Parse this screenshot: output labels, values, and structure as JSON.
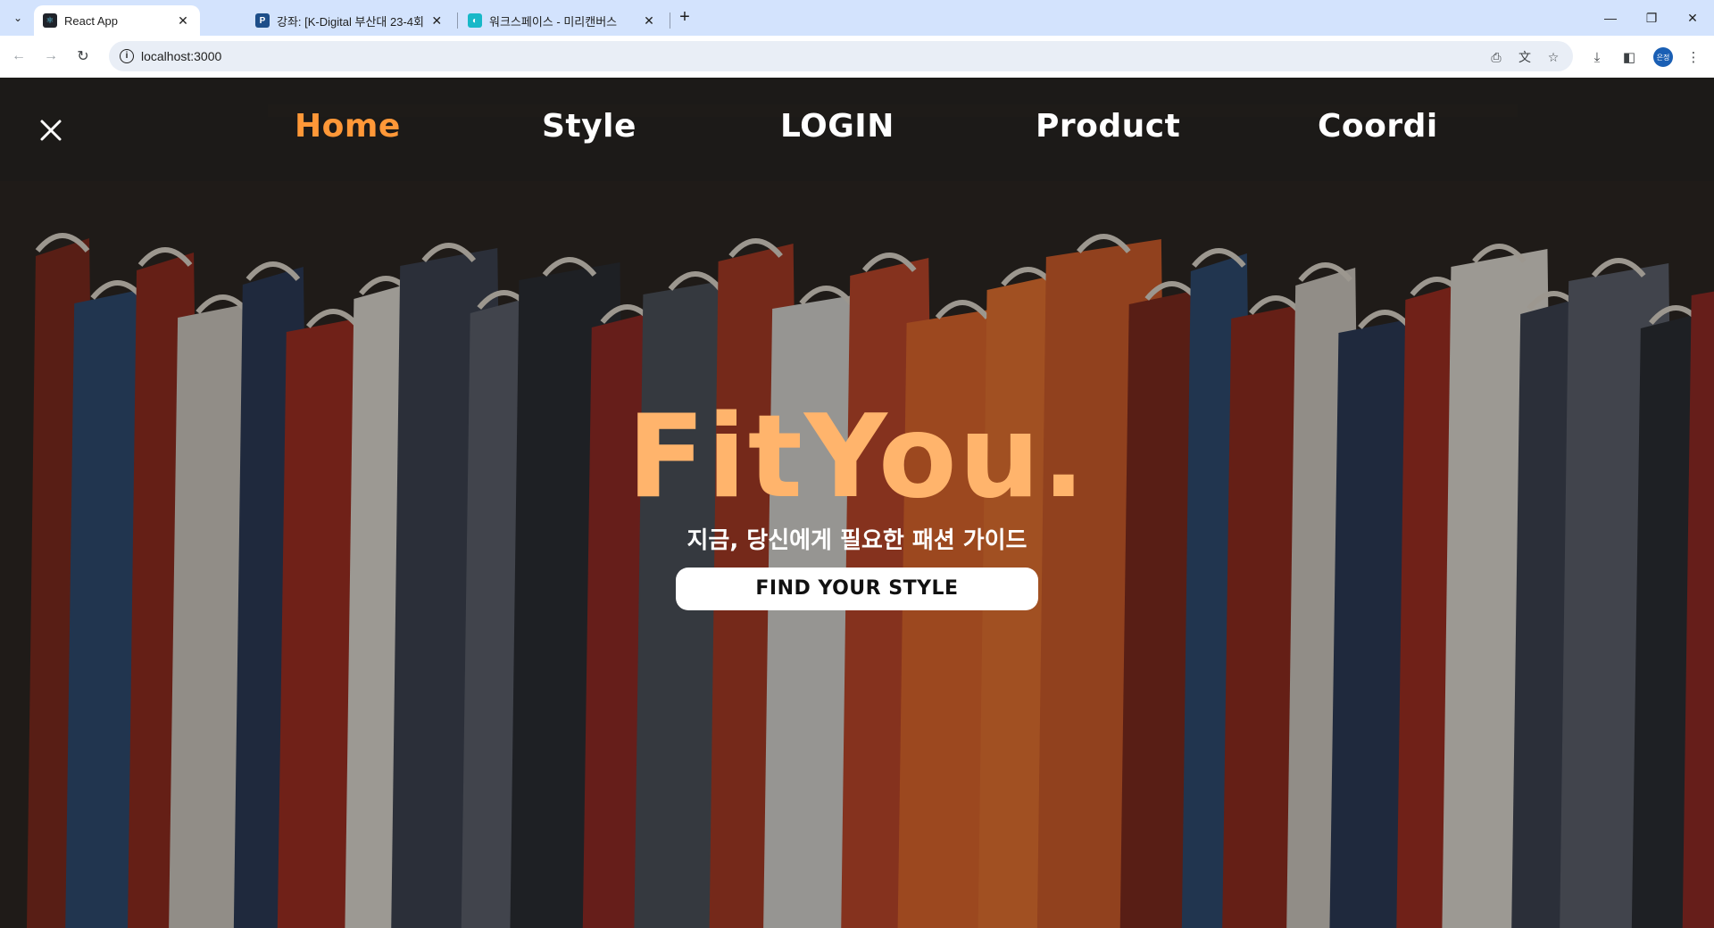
{
  "browser": {
    "tabs": [
      {
        "title": "React App",
        "favicon_color": "#20232a",
        "favicon_glyph": "⚛",
        "active": true
      },
      {
        "title": "강좌: [K-Digital 부산대 23-4회]",
        "favicon_color": "#1d4e89",
        "favicon_glyph": "P",
        "active": false
      },
      {
        "title": "워크스페이스 - 미리캔버스",
        "favicon_color": "#18b8c8",
        "favicon_glyph": "◐",
        "active": false
      }
    ],
    "address": "localhost:3000",
    "profile_label": "은정"
  },
  "site": {
    "nav": [
      {
        "label": "Home",
        "active": true
      },
      {
        "label": "Style",
        "active": false
      },
      {
        "label": "LOGIN",
        "active": false
      },
      {
        "label": "Product",
        "active": false
      },
      {
        "label": "Coordi",
        "active": false
      }
    ],
    "hero": {
      "title": "FitYou.",
      "subtitle": "지금, 당신에게 필요한 패션 가이드",
      "cta": "FIND YOUR STYLE"
    }
  },
  "colors": {
    "accent": "#ff9838",
    "hero_title": "#ffb46c",
    "nav_text": "#ffffff",
    "chrome_tabstrip": "#d3e3fd"
  },
  "icons": {
    "menu_close": "close-icon",
    "reload": "reload-icon",
    "back": "back-arrow-icon",
    "forward": "forward-arrow-icon",
    "bookmark": "star-icon",
    "download": "download-icon",
    "sidepanel": "side-panel-icon",
    "translate": "translate-icon",
    "install": "install-app-icon",
    "more": "kebab-menu-icon"
  }
}
